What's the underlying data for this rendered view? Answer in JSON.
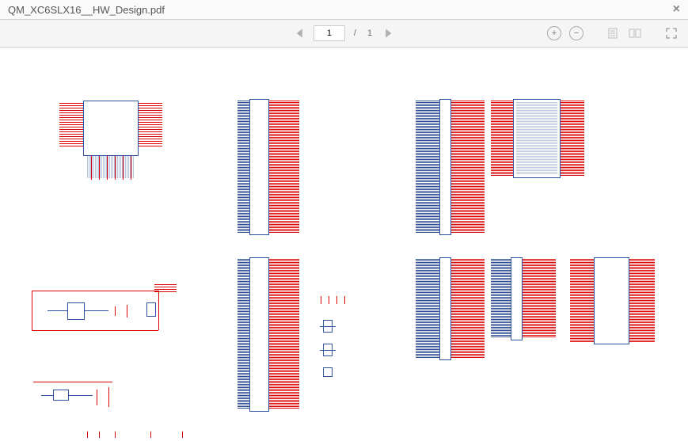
{
  "header": {
    "title": "QM_XC6SLX16__HW_Design.pdf",
    "close": "×"
  },
  "nav": {
    "page": "1",
    "sep": "/",
    "total": "1"
  },
  "tools": {
    "zoom_in": "+",
    "zoom_out": "−"
  }
}
